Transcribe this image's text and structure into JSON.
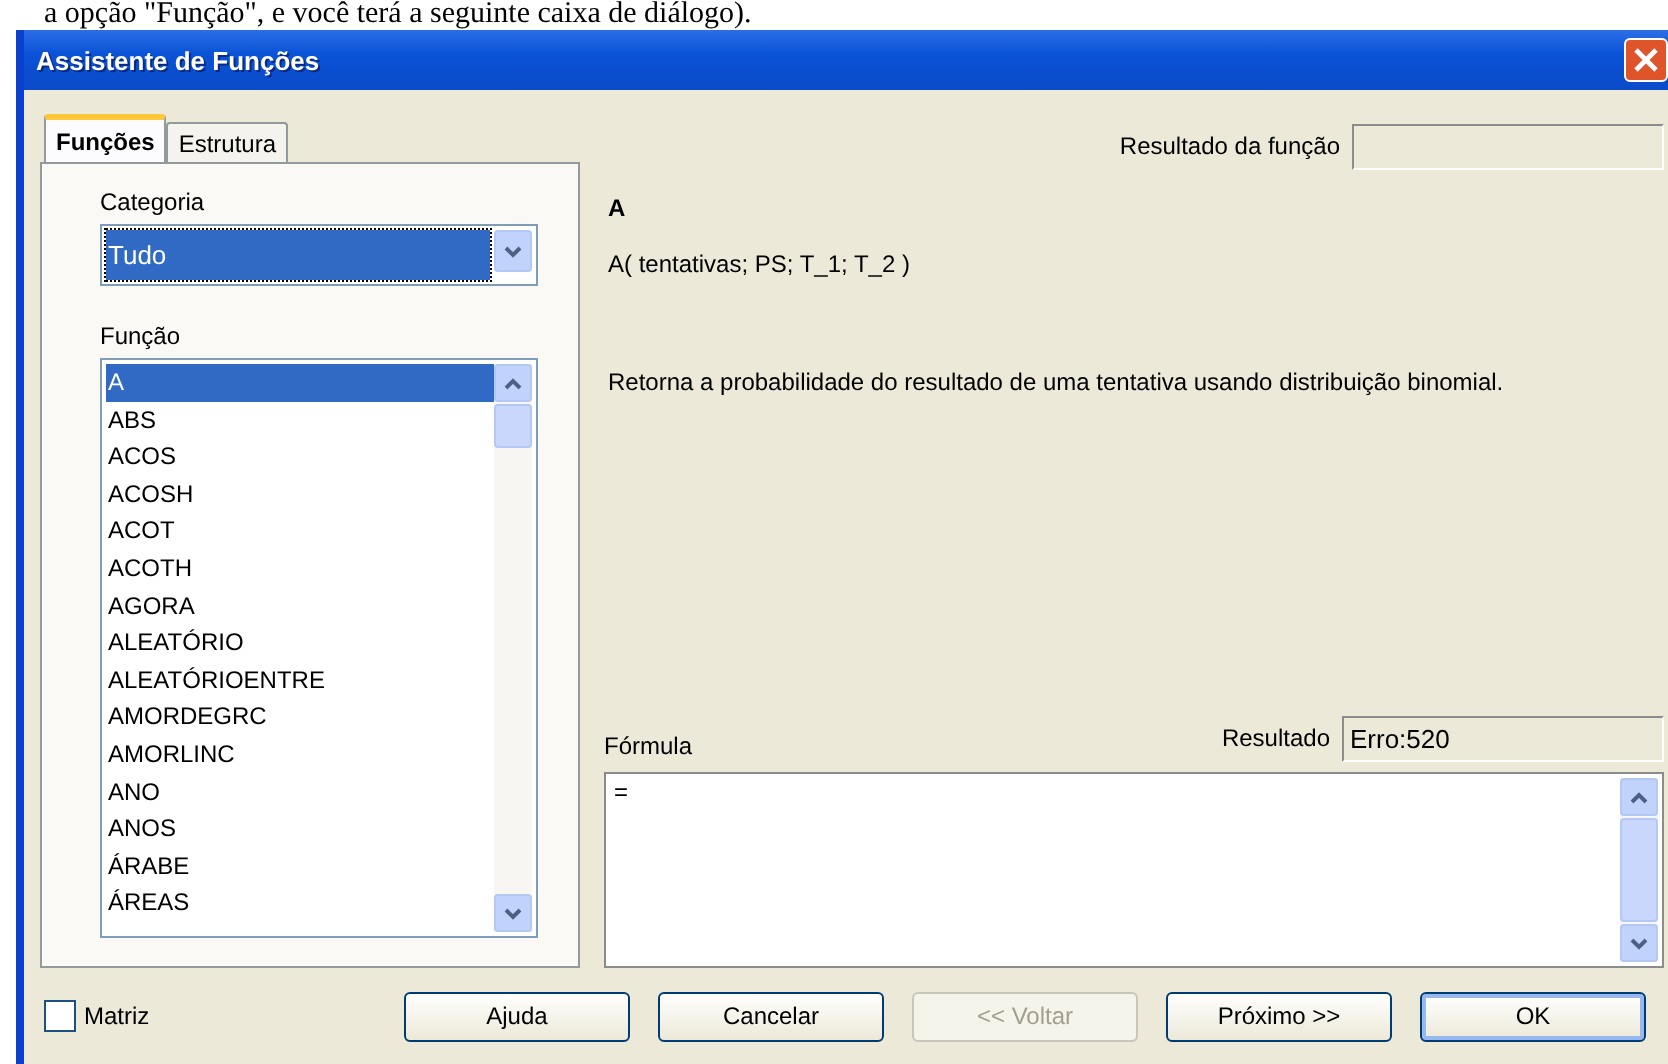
{
  "document_text": "a opção \"Função\", e você terá a seguinte caixa de diálogo).",
  "window": {
    "title": "Assistente de Funções"
  },
  "tabs": [
    {
      "label": "Funções",
      "selected": true
    },
    {
      "label": "Estrutura",
      "selected": false
    }
  ],
  "category": {
    "label": "Categoria",
    "value": "Tudo"
  },
  "function_list": {
    "label": "Função",
    "items": [
      {
        "name": "A",
        "selected": true
      },
      {
        "name": "ABS",
        "selected": false
      },
      {
        "name": "ACOS",
        "selected": false
      },
      {
        "name": "ACOSH",
        "selected": false
      },
      {
        "name": "ACOT",
        "selected": false
      },
      {
        "name": "ACOTH",
        "selected": false
      },
      {
        "name": "AGORA",
        "selected": false
      },
      {
        "name": "ALEATÓRIO",
        "selected": false
      },
      {
        "name": "ALEATÓRIOENTRE",
        "selected": false
      },
      {
        "name": "AMORDEGRC",
        "selected": false
      },
      {
        "name": "AMORLINC",
        "selected": false
      },
      {
        "name": "ANO",
        "selected": false
      },
      {
        "name": "ANOS",
        "selected": false
      },
      {
        "name": "ÁRABE",
        "selected": false
      },
      {
        "name": "ÁREAS",
        "selected": false
      }
    ]
  },
  "function_result": {
    "label": "Resultado da função"
  },
  "function_name": "A",
  "function_signature": "A( tentativas; PS; T_1; T_2 )",
  "function_description": "Retorna a probabilidade do resultado de uma tentativa usando distribuição binomial.",
  "formula": {
    "label": "Fórmula",
    "value": "=",
    "result_label": "Resultado",
    "result_value": "Erro:520"
  },
  "matrix": {
    "label": "Matriz",
    "checked": false
  },
  "buttons": [
    {
      "label": "Ajuda",
      "disabled": false,
      "default": false
    },
    {
      "label": "Cancelar",
      "disabled": false,
      "default": false
    },
    {
      "label": "<< Voltar",
      "disabled": true,
      "default": false
    },
    {
      "label": "Próximo >>",
      "disabled": false,
      "default": false
    },
    {
      "label": "OK",
      "disabled": false,
      "default": true
    }
  ]
}
